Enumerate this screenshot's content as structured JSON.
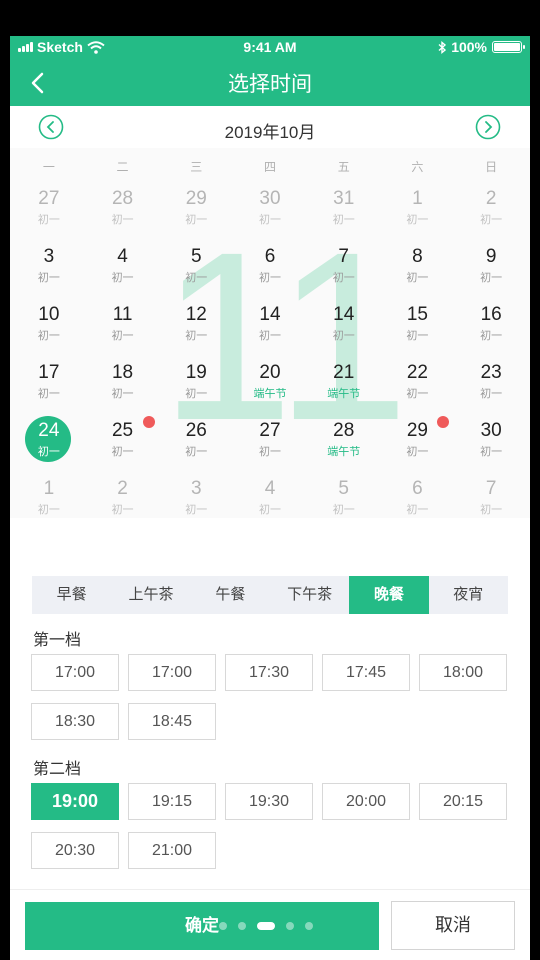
{
  "status": {
    "carrier": "Sketch",
    "time": "9:41 AM",
    "battery": "100%"
  },
  "nav": {
    "title": "选择时间",
    "back_icon": "chevron-left-icon"
  },
  "calendar": {
    "month_title": "2019年10月",
    "big_day": "11",
    "weekdays": [
      "一",
      "二",
      "三",
      "四",
      "五",
      "六",
      "日"
    ],
    "weeks": [
      [
        {
          "d": "27",
          "l": "初一",
          "other": true
        },
        {
          "d": "28",
          "l": "初一",
          "other": true
        },
        {
          "d": "29",
          "l": "初一",
          "other": true
        },
        {
          "d": "30",
          "l": "初一",
          "other": true
        },
        {
          "d": "31",
          "l": "初一",
          "other": true
        },
        {
          "d": "1",
          "l": "初一",
          "other": true
        },
        {
          "d": "2",
          "l": "初一",
          "other": true
        }
      ],
      [
        {
          "d": "3",
          "l": "初一"
        },
        {
          "d": "4",
          "l": "初一"
        },
        {
          "d": "5",
          "l": "初一"
        },
        {
          "d": "6",
          "l": "初一"
        },
        {
          "d": "7",
          "l": "初一"
        },
        {
          "d": "8",
          "l": "初一"
        },
        {
          "d": "9",
          "l": "初一"
        }
      ],
      [
        {
          "d": "10",
          "l": "初一"
        },
        {
          "d": "11",
          "l": "初一"
        },
        {
          "d": "12",
          "l": "初一"
        },
        {
          "d": "14",
          "l": "初一"
        },
        {
          "d": "14",
          "l": "初一"
        },
        {
          "d": "15",
          "l": "初一"
        },
        {
          "d": "16",
          "l": "初一"
        }
      ],
      [
        {
          "d": "17",
          "l": "初一"
        },
        {
          "d": "18",
          "l": "初一"
        },
        {
          "d": "19",
          "l": "初一"
        },
        {
          "d": "20",
          "l": "端午节",
          "festival": true
        },
        {
          "d": "21",
          "l": "端午节",
          "festival": true
        },
        {
          "d": "22",
          "l": "初一"
        },
        {
          "d": "23",
          "l": "初一"
        }
      ],
      [
        {
          "d": "24",
          "l": "初一",
          "selected": true
        },
        {
          "d": "25",
          "l": "初一",
          "dot": true
        },
        {
          "d": "26",
          "l": "初一"
        },
        {
          "d": "27",
          "l": "初一"
        },
        {
          "d": "28",
          "l": "端午节",
          "festival": true
        },
        {
          "d": "29",
          "l": "初一",
          "dot": true
        },
        {
          "d": "30",
          "l": "初一"
        }
      ],
      [
        {
          "d": "1",
          "l": "初一",
          "other": true
        },
        {
          "d": "2",
          "l": "初一",
          "other": true
        },
        {
          "d": "3",
          "l": "初一",
          "other": true
        },
        {
          "d": "4",
          "l": "初一",
          "other": true
        },
        {
          "d": "5",
          "l": "初一",
          "other": true
        },
        {
          "d": "6",
          "l": "初一",
          "other": true
        },
        {
          "d": "7",
          "l": "初一",
          "other": true
        }
      ]
    ]
  },
  "meal_tabs": [
    {
      "label": "早餐"
    },
    {
      "label": "上午茶"
    },
    {
      "label": "午餐"
    },
    {
      "label": "下午茶"
    },
    {
      "label": "晚餐",
      "active": true
    },
    {
      "label": "夜宵"
    }
  ],
  "groups": [
    {
      "label": "第一档",
      "slots": [
        {
          "time": "17:00"
        },
        {
          "time": "17:00"
        },
        {
          "time": "17:30"
        },
        {
          "time": "17:45"
        },
        {
          "time": "18:00"
        },
        {
          "time": "18:30"
        },
        {
          "time": "18:45"
        }
      ]
    },
    {
      "label": "第二档",
      "slots": [
        {
          "time": "19:00",
          "active": true
        },
        {
          "time": "19:15"
        },
        {
          "time": "19:30"
        },
        {
          "time": "20:00"
        },
        {
          "time": "20:15"
        },
        {
          "time": "20:30"
        },
        {
          "time": "21:00"
        }
      ]
    }
  ],
  "footer": {
    "confirm": "确定",
    "cancel": "取消",
    "pager_count": 5,
    "pager_active": 2
  },
  "colors": {
    "accent": "#24bb86",
    "dot": "#ef5a5a"
  }
}
